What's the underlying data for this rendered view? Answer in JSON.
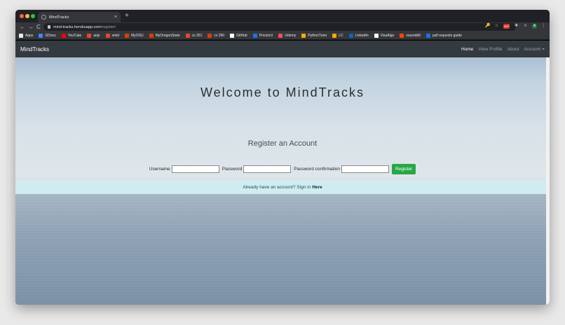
{
  "browser": {
    "tab_title": "MindTracks",
    "new_tab": "+",
    "tab_close": "×",
    "url_host": "mind-tracks.herokuapp.com",
    "url_path": "/register/",
    "nav_back": "←",
    "nav_forward": "→",
    "nav_reload": "C",
    "extensions": [
      "🔑",
      "☆",
      "ABP",
      "✚",
      "≡",
      "A",
      "⋮"
    ],
    "bookmarks": [
      {
        "label": "Apps",
        "color": "#e8eaed"
      },
      {
        "label": "GDocs",
        "color": "#4285f4"
      },
      {
        "label": "YouTube",
        "color": "#ff0000"
      },
      {
        "label": "aojx",
        "color": "#ea4335"
      },
      {
        "label": "smid",
        "color": "#ea4335"
      },
      {
        "label": "MyOSU",
        "color": "#d73f09"
      },
      {
        "label": "MyOregonState",
        "color": "#d73f09"
      },
      {
        "label": "cs 261",
        "color": "#ea4335"
      },
      {
        "label": "cs 290",
        "color": "#d73f09"
      },
      {
        "label": "GitHub",
        "color": "#ffffff"
      },
      {
        "label": "ProctorU",
        "color": "#1a73e8"
      },
      {
        "label": "Udemy",
        "color": "#ec5252"
      },
      {
        "label": "PythonTutor",
        "color": "#f9ab00"
      },
      {
        "label": "LC",
        "color": "#f9ab00"
      },
      {
        "label": "LinkedIn",
        "color": "#0a66c2"
      },
      {
        "label": "VisuAlgo",
        "color": "#ffffff"
      },
      {
        "label": "osureddit",
        "color": "#ff4500"
      },
      {
        "label": "pull requests guide",
        "color": "#1a73e8"
      }
    ]
  },
  "navbar": {
    "brand": "MindTracks",
    "links": [
      "Home",
      "View Profile",
      "About",
      "Account"
    ]
  },
  "hero": {
    "welcome": "Welcome to MindTracks",
    "register_title": "Register an Account"
  },
  "form": {
    "username_label": "Username",
    "password_label": "Password",
    "confirm_label": "Password confirmation",
    "username_value": "",
    "password_value": "",
    "confirm_value": "",
    "submit_label": "Register"
  },
  "alert": {
    "prefix": "Already have an account? Sign in",
    "link": "Here"
  },
  "colors": {
    "navbar_bg": "#343a40",
    "register_button": "#28a745",
    "alert_bg": "#d1ecf1"
  }
}
